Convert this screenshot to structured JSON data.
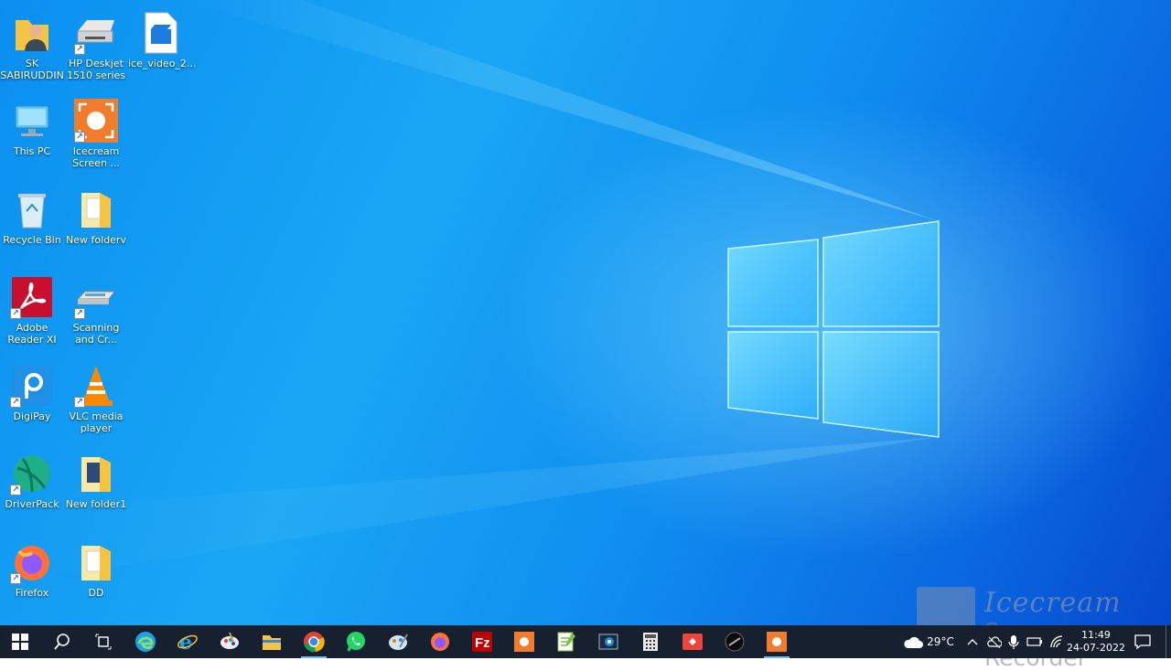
{
  "desktop": {
    "icons": [
      {
        "id": "sk-sabiruddin",
        "line1": "SK",
        "line2": "SABIRUDDIN"
      },
      {
        "id": "hp-deskjet",
        "line1": "HP Deskjet",
        "line2": "1510 series"
      },
      {
        "id": "ice-video",
        "line1": "ice_video_2...",
        "line2": ""
      },
      {
        "id": "this-pc",
        "line1": "This PC",
        "line2": ""
      },
      {
        "id": "icecream-screen",
        "line1": "Icecream",
        "line2": "Screen ..."
      },
      {
        "id": "recycle-bin",
        "line1": "Recycle Bin",
        "line2": ""
      },
      {
        "id": "new-folderv",
        "line1": "New folderv",
        "line2": ""
      },
      {
        "id": "adobe-reader",
        "line1": "Adobe",
        "line2": "Reader XI"
      },
      {
        "id": "scanning",
        "line1": "Scanning",
        "line2": "and Cr..."
      },
      {
        "id": "digipay",
        "line1": "DigiPay",
        "line2": ""
      },
      {
        "id": "vlc",
        "line1": "VLC media",
        "line2": "player"
      },
      {
        "id": "driverpack",
        "line1": "DriverPack",
        "line2": ""
      },
      {
        "id": "new-folder1",
        "line1": "New folder1",
        "line2": ""
      },
      {
        "id": "firefox",
        "line1": "Firefox",
        "line2": ""
      },
      {
        "id": "dd",
        "line1": "DD",
        "line2": ""
      }
    ]
  },
  "taskbar": {
    "apps": [
      "start-icon",
      "search-icon",
      "task-view-icon",
      "edge-icon",
      "internet-explorer-icon",
      "paint-icon",
      "file-explorer-icon",
      "chrome-icon",
      "whatsapp-icon",
      "paint-3d-icon",
      "firefox-icon",
      "filezilla-icon",
      "icecream-icon",
      "notepad-plus-icon",
      "photo-viewer-icon",
      "calculator-icon",
      "anydesk-icon",
      "dark-app-icon",
      "icecream-recorder-icon"
    ],
    "weather": {
      "temp": "29°C"
    },
    "clock": {
      "time": "11:49",
      "date": "24-07-2022"
    }
  },
  "watermark": {
    "line1": "Icecream",
    "line2": "Screen Recorder"
  },
  "colors": {
    "taskbar": "#16202e",
    "accent": "#76b9ed",
    "desktop": "#0f8ef0"
  }
}
